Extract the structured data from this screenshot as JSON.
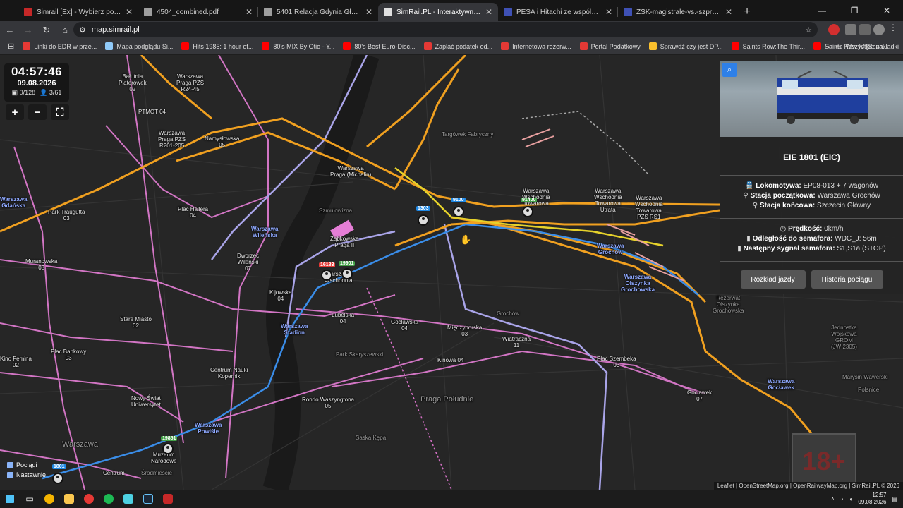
{
  "browser": {
    "tabs": [
      {
        "title": "Simrail [Ex] - Wybierz pociąg",
        "color": "#c62828"
      },
      {
        "title": "4504_combined.pdf",
        "color": "#9e9e9e"
      },
      {
        "title": "5401 Relacja Gdynia Główna - C",
        "color": "#9e9e9e"
      },
      {
        "title": "SimRail.PL - Interaktywna mapa",
        "color": "#e0e0e0",
        "active": true
      },
      {
        "title": "PESA i Hitachi ze wspólną ofert",
        "color": "#3f51b5"
      },
      {
        "title": "ZSK-magistrale-vs.-szprychy-p",
        "color": "#3f51b5"
      }
    ],
    "url": "map.simrail.pl",
    "bookmarks": [
      {
        "label": "Linki do EDR w prze...",
        "color": "#e53935"
      },
      {
        "label": "Mapa podglądu Si...",
        "color": "#90caf9"
      },
      {
        "label": "Hits 1985: 1 hour of...",
        "color": "#ff0000"
      },
      {
        "label": "80's MIX By Otio - Y...",
        "color": "#ff0000"
      },
      {
        "label": "80's Best Euro-Disc...",
        "color": "#ff0000"
      },
      {
        "label": "Zapłać podatek od...",
        "color": "#e53935"
      },
      {
        "label": "Internetowa rezerw...",
        "color": "#e53935"
      },
      {
        "label": "Portal Podatkowy",
        "color": "#e53935"
      },
      {
        "label": "Sprawdź czy jest DP...",
        "color": "#fbc02d"
      },
      {
        "label": "Saints Row:The Thir...",
        "color": "#ff0000"
      },
      {
        "label": "Saints Row IV [Soun...",
        "color": "#ff0000"
      }
    ],
    "bookmarks_all": "Wszystkie zakładki"
  },
  "map": {
    "clock": {
      "time": "04:57:46",
      "date": "09.08.2026",
      "trains": "0/128",
      "players": "3/61"
    },
    "labels": [
      {
        "t": "Bałutnia\nPlaterówek\n02"
      },
      {
        "t": "Warszawa\nPraga PZS\nR24-45"
      },
      {
        "t": "PTMOT 04"
      },
      {
        "t": "Warszawa\nPraga PZS\nR201-205"
      },
      {
        "t": "Namysłowska\n05"
      },
      {
        "t": "Warszawa\nPraga (Michalin)"
      },
      {
        "t": "Warszawa\nGdańska"
      },
      {
        "t": "Park Traugutta\n03"
      },
      {
        "t": "Plac Hallera\n04"
      },
      {
        "t": "Warszawa\nWileńska"
      },
      {
        "t": "Dworzec\nWileński\n07"
      },
      {
        "t": "Ząbkowska\nPraga II"
      },
      {
        "t": "Warszawa\nWschodnia"
      },
      {
        "t": "Kijowska\n04"
      },
      {
        "t": "Warszawa\nStadion"
      },
      {
        "t": "Lubelska\n04"
      },
      {
        "t": "Gocławska\n04"
      },
      {
        "t": "Międzyborska\n03"
      },
      {
        "t": "Wiatraczna\n11"
      },
      {
        "t": "Warszawa\nWschodnia\nTowarowa"
      },
      {
        "t": "Warszawa\nWschodnia\nTowarowa\nUtrata"
      },
      {
        "t": "Warszawa\nWschodnia\nTowarowa\nPZS RS1"
      },
      {
        "t": "Warszawa\nGrochów"
      },
      {
        "t": "Warszawa\nOlszynka\nGrochowska"
      },
      {
        "t": "Kinowa 04"
      },
      {
        "t": "Plac Szembeka\n03"
      },
      {
        "t": "Gocławek\n07"
      },
      {
        "t": "Warszawa\nGocławek"
      },
      {
        "t": "Centrum Nauki\nKopernik"
      },
      {
        "t": "Nowy Świat\nUniwersytet"
      },
      {
        "t": "Rondo Waszyngtona\n05"
      },
      {
        "t": "Muzeum\nNarodowe"
      },
      {
        "t": "Warszawa\nPowiśle"
      },
      {
        "t": "Stare Miasto\n02"
      },
      {
        "t": "Plac Bankowy\n03"
      },
      {
        "t": "Kino Femina\n02"
      },
      {
        "t": "Muranowska\n03"
      },
      {
        "t": "Centrum"
      },
      {
        "t": "Śródmieście"
      },
      {
        "t": "Warszawa"
      },
      {
        "t": "Praga Południe"
      },
      {
        "t": "Grochów"
      },
      {
        "t": "Szmulowizna"
      },
      {
        "t": "Targówek Fabryczny"
      },
      {
        "t": "Park Skaryszewski"
      },
      {
        "t": "Rezerwat\nOlszynka\nGrochowska"
      },
      {
        "t": "Jednostka\nWojskowa\nGROM\n(JW 2305)"
      },
      {
        "t": "Marysin Wawerski"
      },
      {
        "t": "Polsnice"
      },
      {
        "t": "Saska Kępa"
      }
    ],
    "train_badges": [
      {
        "id": "9100",
        "color": "#1e88e5"
      },
      {
        "id": "91400",
        "color": "#43a047"
      },
      {
        "id": "1303",
        "color": "#1e88e5"
      },
      {
        "id": "16183",
        "color": "#e53935"
      },
      {
        "id": "19901",
        "color": "#43a047"
      },
      {
        "id": "19851",
        "color": "#43a047"
      },
      {
        "id": "1801",
        "color": "#1e88e5"
      }
    ],
    "layers": {
      "trains": "Pociągi",
      "signals": "Nastawnie"
    },
    "attribution": "Leaflet | OpenStreetMap.org | OpenRailwayMap.org | SimRail.PL © 2026",
    "rating": "18+"
  },
  "train": {
    "name": "EIE 1801 (EIC)",
    "loco_label": "Lokomotywa:",
    "loco_value": "EP08-013 + 7 wagonów",
    "start_label": "Stacja początkowa:",
    "start_value": "Warszawa Grochów",
    "end_label": "Stacja końcowa:",
    "end_value": "Szczecin Główny",
    "speed_label": "Prędkość:",
    "speed_value": "0km/h",
    "dist_label": "Odległość do semafora:",
    "dist_value": "WDC_J: 56m",
    "signal_label": "Następny sygnał semafora:",
    "signal_value": "S1,S1a (STOP)",
    "btn_schedule": "Rozkład jazdy",
    "btn_history": "Historia pociągu"
  },
  "taskbar": {
    "time": "12:57",
    "date": "09.08.2026"
  }
}
